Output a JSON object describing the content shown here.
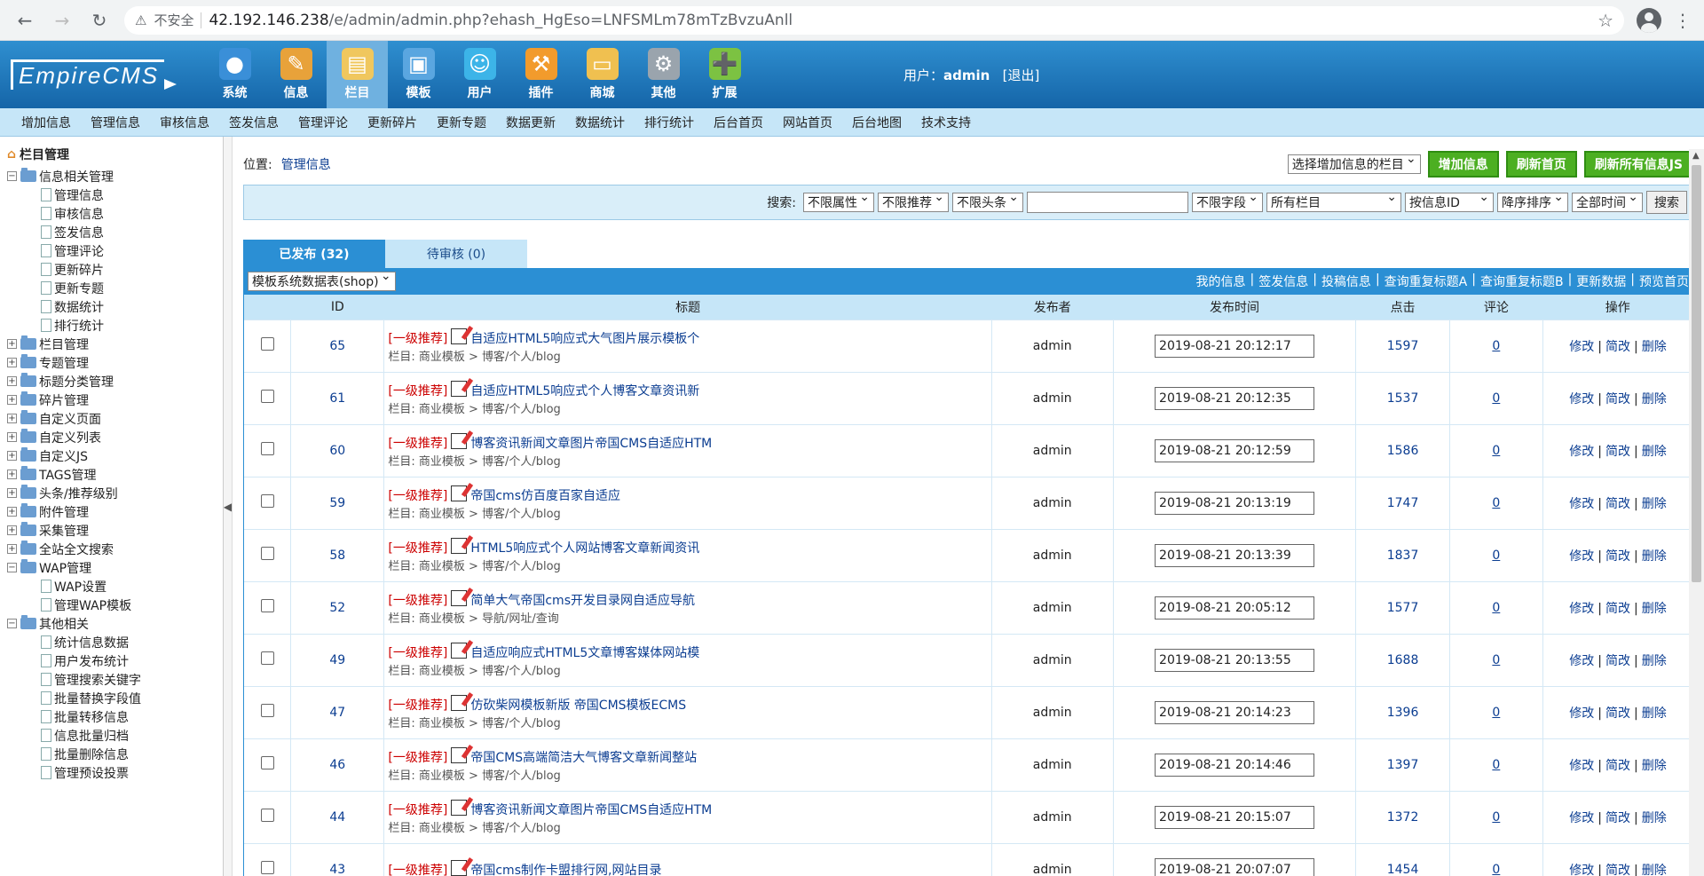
{
  "browser": {
    "security_warning": "不安全",
    "url_host": "42.192.146.238",
    "url_rest": "/e/admin/admin.php?ehash_HgEso=LNFSMLm78mTzBvzuAnll"
  },
  "header": {
    "logo": "EmpireCMS",
    "menu": [
      {
        "label": "系统",
        "icon": "globe-icon",
        "color": "#3a8fd8"
      },
      {
        "label": "信息",
        "icon": "notepad-icon",
        "color": "#e8a23a"
      },
      {
        "label": "栏目",
        "icon": "folder-icon",
        "color": "#f0c75e"
      },
      {
        "label": "模板",
        "icon": "window-icon",
        "color": "#5aa6e0"
      },
      {
        "label": "用户",
        "icon": "user-icon",
        "color": "#3cb4e8"
      },
      {
        "label": "插件",
        "icon": "tools-icon",
        "color": "#f29b2c"
      },
      {
        "label": "商城",
        "icon": "card-icon",
        "color": "#f0c050"
      },
      {
        "label": "其他",
        "icon": "gear-icon",
        "color": "#9aa4ad"
      },
      {
        "label": "扩展",
        "icon": "plus-icon",
        "color": "#7cc242"
      }
    ],
    "user_label": "用户：",
    "user_name": "admin",
    "logout": "[退出]"
  },
  "sub_menu": [
    "增加信息",
    "管理信息",
    "审核信息",
    "签发信息",
    "管理评论",
    "更新碎片",
    "更新专题",
    "数据更新",
    "数据统计",
    "排行统计",
    "后台首页",
    "网站首页",
    "后台地图",
    "技术支持"
  ],
  "sidebar": {
    "title": "栏目管理",
    "tree": [
      {
        "label": "信息相关管理",
        "type": "group",
        "open": true
      },
      {
        "label": "管理信息",
        "type": "child"
      },
      {
        "label": "审核信息",
        "type": "child"
      },
      {
        "label": "签发信息",
        "type": "child"
      },
      {
        "label": "管理评论",
        "type": "child"
      },
      {
        "label": "更新碎片",
        "type": "child"
      },
      {
        "label": "更新专题",
        "type": "child"
      },
      {
        "label": "数据统计",
        "type": "child"
      },
      {
        "label": "排行统计",
        "type": "child"
      },
      {
        "label": "栏目管理",
        "type": "group",
        "open": false
      },
      {
        "label": "专题管理",
        "type": "group",
        "open": false
      },
      {
        "label": "标题分类管理",
        "type": "group",
        "open": false
      },
      {
        "label": "碎片管理",
        "type": "group",
        "open": false
      },
      {
        "label": "自定义页面",
        "type": "group",
        "open": false
      },
      {
        "label": "自定义列表",
        "type": "group",
        "open": false
      },
      {
        "label": "自定义JS",
        "type": "group",
        "open": false
      },
      {
        "label": "TAGS管理",
        "type": "group",
        "open": false
      },
      {
        "label": "头条/推荐级别",
        "type": "group",
        "open": false
      },
      {
        "label": "附件管理",
        "type": "group",
        "open": false
      },
      {
        "label": "采集管理",
        "type": "group",
        "open": false
      },
      {
        "label": "全站全文搜索",
        "type": "group",
        "open": false
      },
      {
        "label": "WAP管理",
        "type": "group",
        "open": true
      },
      {
        "label": "WAP设置",
        "type": "child"
      },
      {
        "label": "管理WAP模板",
        "type": "child"
      },
      {
        "label": "其他相关",
        "type": "group",
        "open": true
      },
      {
        "label": "统计信息数据",
        "type": "child"
      },
      {
        "label": "用户发布统计",
        "type": "child"
      },
      {
        "label": "管理搜索关键字",
        "type": "child"
      },
      {
        "label": "批量替换字段值",
        "type": "child"
      },
      {
        "label": "批量转移信息",
        "type": "child"
      },
      {
        "label": "信息批量归档",
        "type": "child"
      },
      {
        "label": "批量删除信息",
        "type": "child"
      },
      {
        "label": "管理预设投票",
        "type": "child"
      }
    ]
  },
  "location": {
    "label": "位置:",
    "link": "管理信息"
  },
  "top_actions": {
    "select_column": "选择增加信息的栏目",
    "add_info": "增加信息",
    "refresh_home": "刷新首页",
    "refresh_js": "刷新所有信息JS"
  },
  "search": {
    "label": "搜索:",
    "attr": "不限属性",
    "recommend": "不限推荐",
    "headline": "不限头条",
    "field": "不限字段",
    "column": "所有栏目",
    "order_by": "按信息ID",
    "order": "降序排序",
    "time": "全部时间",
    "button": "搜索"
  },
  "tabs": {
    "published": "已发布 (32)",
    "pending": "待审核 (0)"
  },
  "table_top": {
    "db_select": "模板系统数据表(shop)",
    "links": [
      "我的信息",
      "签发信息",
      "投稿信息",
      "查询重复标题A",
      "查询重复标题B",
      "更新数据",
      "预览首页"
    ]
  },
  "table": {
    "headers": [
      "",
      "ID",
      "标题",
      "发布者",
      "发布时间",
      "点击",
      "评论",
      "操作"
    ],
    "rec_label": "[一级推荐]",
    "col_prefix": "栏目:",
    "ops": [
      "修改",
      "简改",
      "删除"
    ],
    "rows": [
      {
        "id": "65",
        "title": "自适应HTML5响应式大气图片展示模板个",
        "column": "商业模板 > 博客/个人/blog",
        "author": "admin",
        "time": "2019-08-21 20:12:17",
        "hits": "1597",
        "comments": "0"
      },
      {
        "id": "61",
        "title": "自适应HTML5响应式个人博客文章资讯新",
        "column": "商业模板 > 博客/个人/blog",
        "author": "admin",
        "time": "2019-08-21 20:12:35",
        "hits": "1537",
        "comments": "0"
      },
      {
        "id": "60",
        "title": "博客资讯新闻文章图片帝国CMS自适应HTM",
        "column": "商业模板 > 博客/个人/blog",
        "author": "admin",
        "time": "2019-08-21 20:12:59",
        "hits": "1586",
        "comments": "0"
      },
      {
        "id": "59",
        "title": "帝国cms仿百度百家自适应",
        "column": "商业模板 > 博客/个人/blog",
        "author": "admin",
        "time": "2019-08-21 20:13:19",
        "hits": "1747",
        "comments": "0"
      },
      {
        "id": "58",
        "title": "HTML5响应式个人网站博客文章新闻资讯",
        "column": "商业模板 > 博客/个人/blog",
        "author": "admin",
        "time": "2019-08-21 20:13:39",
        "hits": "1837",
        "comments": "0"
      },
      {
        "id": "52",
        "title": "简单大气帝国cms开发目录网自适应导航",
        "column": "商业模板 > 导航/网址/查询",
        "author": "admin",
        "time": "2019-08-21 20:05:12",
        "hits": "1577",
        "comments": "0"
      },
      {
        "id": "49",
        "title": "自适应响应式HTML5文章博客媒体网站模",
        "column": "商业模板 > 博客/个人/blog",
        "author": "admin",
        "time": "2019-08-21 20:13:55",
        "hits": "1688",
        "comments": "0"
      },
      {
        "id": "47",
        "title": "仿砍柴网模板新版 帝国CMS模板ECMS",
        "column": "商业模板 > 博客/个人/blog",
        "author": "admin",
        "time": "2019-08-21 20:14:23",
        "hits": "1396",
        "comments": "0"
      },
      {
        "id": "46",
        "title": "帝国CMS高端简洁大气博客文章新闻整站",
        "column": "商业模板 > 博客/个人/blog",
        "author": "admin",
        "time": "2019-08-21 20:14:46",
        "hits": "1397",
        "comments": "0"
      },
      {
        "id": "44",
        "title": "博客资讯新闻文章图片帝国CMS自适应HTM",
        "column": "商业模板 > 博客/个人/blog",
        "author": "admin",
        "time": "2019-08-21 20:15:07",
        "hits": "1372",
        "comments": "0"
      },
      {
        "id": "43",
        "title": "帝国cms制作卡盟排行网,网站目录",
        "column": "",
        "author": "admin",
        "time": "2019-08-21 20:07:07",
        "hits": "1454",
        "comments": "0"
      }
    ]
  }
}
